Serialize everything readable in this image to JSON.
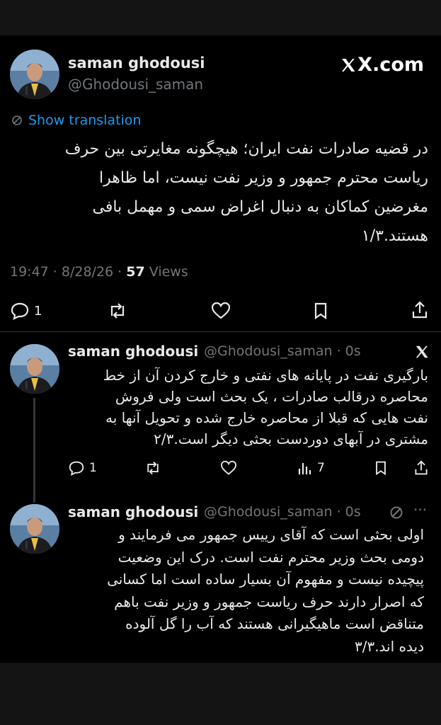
{
  "brand": {
    "label": "X.com"
  },
  "main_tweet": {
    "author_name": "saman ghodousi",
    "author_handle": "@Ghodousi_saman",
    "translate_label": "Show translation",
    "lines": [
      "در قضیه صادرات نفت ایران؛ هیچگونه مغایرتی بین حرف",
      "ریاست محترم جمهور و وزیر نفت نیست، اما ظاهرا",
      "مغرضین کماکان به دنبال اغراض سمی و مهمل بافی",
      "هستند.۱/۳"
    ],
    "time": "19:47 · 8/28/26 · ",
    "views_count": "57",
    "views_label": " Views",
    "reply_count": "1"
  },
  "reply_1": {
    "author_name": "saman ghodousi",
    "handle_time": "@Ghodousi_saman · 0s",
    "lines": [
      "بارگیری نفت در پایانه های نفتی و خارج کردن آن از خط",
      "محاصره درقالب صادرات ، یک بحث است ولی فروش",
      "نفت هایی که قبلا از محاصره خارج شده و تحویل آنها به",
      "مشتری در آبهای دوردست بحثی دیگر است.۲/۳"
    ],
    "reply_count": "1",
    "views_count": "7"
  },
  "reply_2": {
    "author_name": "saman ghodousi",
    "handle_time": "@Ghodousi_saman · 0s",
    "more": "···",
    "lines": [
      "اولی بحثی است که آقای رییس جمهور می فرمایند و",
      "دومی بحث وزیر محترم نفت است. درک این وضعیت",
      "پیچیده نیست و مفهوم آن بسیار ساده است اما کسانی",
      "که اصرار دارند حرف ریاست جمهور و وزیر نفت باهم",
      "متناقض است ماهیگیرانی هستند که آب را گل آلوده",
      "دیده اند.۳/۳"
    ]
  }
}
